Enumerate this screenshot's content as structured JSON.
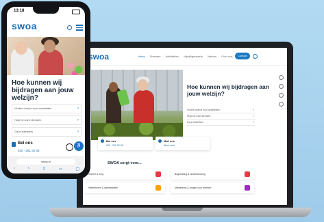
{
  "laptop": {
    "logo": "swoa",
    "nav": [
      "Home",
      "Diensten",
      "Activiteiten",
      "Vrijwilligerswerk",
      "Nieuws",
      "Over ons"
    ],
    "contact_button": "Contact",
    "hero_title": "Hoe kunnen wij bijdragen aan jouw welzijn?",
    "links": [
      "Vinden doet je voor activiteiten",
      "Hulp bij onze diensten",
      "Ga je trainsfers"
    ],
    "card1": {
      "title": "Bel ons",
      "sub": "020 - 261 32 08"
    },
    "card2": {
      "title": "Mail ons",
      "sub": "Stuur mail"
    },
    "section_title": "SWOA zorgt voor...",
    "tiles": [
      "Wonen & zorg",
      "Begeleiding & ondersteuning",
      "Welbehoren & administratie",
      "Mantelzorg & zorgen voor mensen"
    ],
    "colors": {
      "accent": "#1a6fb5",
      "tile_icons": [
        "#e63946",
        "#e63946",
        "#f4a300",
        "#9b2ec1"
      ]
    }
  },
  "phone": {
    "time": "13:18",
    "logo": "swoa",
    "hero_title": "Hoe kunnen wij bijdragen aan jouw welzijn?",
    "links": [
      "Vinden doet je voor activiteiten",
      "Hulp bij onze diensten",
      "Ga je trainsfers"
    ],
    "bel_ons": "Bel ons",
    "phone_number": "020 - 261 32 08",
    "url": "swoa.nl",
    "icons": [
      "back-icon",
      "forward-icon",
      "share-icon",
      "bookmarks-icon",
      "tabs-icon"
    ]
  }
}
